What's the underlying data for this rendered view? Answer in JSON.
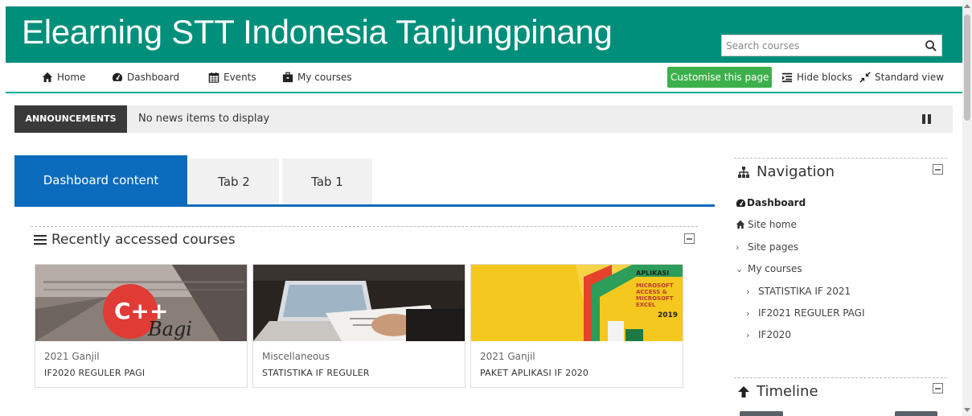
{
  "header": {
    "site_title": "Elearning STT Indonesia Tanjungpinang",
    "search_placeholder": "Search courses",
    "bg_color": "#008f7a"
  },
  "navbar": {
    "items": [
      {
        "label": "Home",
        "icon": "home-icon"
      },
      {
        "label": "Dashboard",
        "icon": "dashboard-icon"
      },
      {
        "label": "Events",
        "icon": "calendar-icon"
      },
      {
        "label": "My courses",
        "icon": "briefcase-icon"
      }
    ],
    "customise_label": "Customise this page",
    "hide_blocks_label": "Hide blocks",
    "standard_view_label": "Standard view"
  },
  "announcements": {
    "label": "ANNOUNCEMENTS",
    "text": "No news items to display"
  },
  "tabs": [
    {
      "label": "Dashboard content",
      "active": true
    },
    {
      "label": "Tab 2",
      "active": false
    },
    {
      "label": "Tab 1",
      "active": false
    }
  ],
  "recent_courses": {
    "title": "Recently accessed courses",
    "courses": [
      {
        "category": "2021 Ganjil",
        "name": "IF2020 REGULER PAGI"
      },
      {
        "category": "Miscellaneous",
        "name": "STATISTIKA IF REGULER"
      },
      {
        "category": "2021 Ganjil",
        "name": "PAKET APLIKASI IF 2020"
      }
    ],
    "image_text": {
      "cpp": "C++",
      "bagi": "Bagi",
      "aplikasi": "APLIKASI",
      "ms_access": "MICROSOFT",
      "access": "ACCESS &",
      "ms_excel": "MICROSOFT",
      "excel": "EXCEL",
      "year": "2019"
    }
  },
  "navigation": {
    "title": "Navigation",
    "items": [
      {
        "label": "Dashboard",
        "icon": "dashboard-icon"
      },
      {
        "label": "Site home",
        "icon": "home-icon"
      },
      {
        "label": "Site pages",
        "chevron": "›"
      },
      {
        "label": "My courses",
        "chevron": "⌄"
      },
      {
        "label": "STATISTIKA IF 2021",
        "chevron": "›"
      },
      {
        "label": "IF2021 REGULER PAGI",
        "chevron": "›"
      },
      {
        "label": "IF2020",
        "chevron": "›"
      }
    ]
  },
  "timeline": {
    "title": "Timeline"
  }
}
